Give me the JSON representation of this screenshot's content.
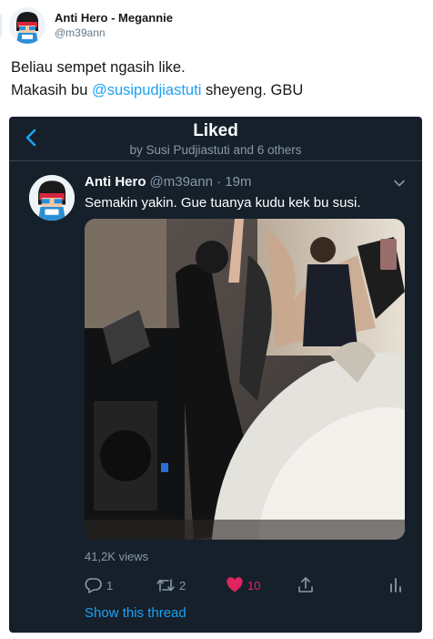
{
  "tweet": {
    "display_name": "Anti Hero - Megannie",
    "handle": "@m39ann",
    "text_line1": "Beliau sempet ngasih like.",
    "text_line2_prefix": "Makasih bu ",
    "text_line2_mention": "@susipudjiastuti",
    "text_line2_suffix": " sheyeng. GBU"
  },
  "screenshot": {
    "header": {
      "title": "Liked",
      "subtitle": "by Susi Pudjiastuti and 6 others"
    },
    "inner_tweet": {
      "name": "Anti Hero",
      "handle_time": "@m39ann · 19m",
      "text": "Semakin yakin. Gue tuanya kudu kek bu susi.",
      "views": "41,2K views",
      "reply_count": "1",
      "retweet_count": "2",
      "like_count": "10",
      "show_thread": "Show this thread"
    }
  },
  "colors": {
    "accent": "#1da1f2",
    "dark_bg": "#15202b",
    "like": "#e0245e",
    "muted": "#8899a6"
  },
  "icons": [
    "chevron-left-icon",
    "chevron-down-icon",
    "reply-icon",
    "retweet-icon",
    "heart-icon",
    "share-icon",
    "analytics-icon"
  ]
}
